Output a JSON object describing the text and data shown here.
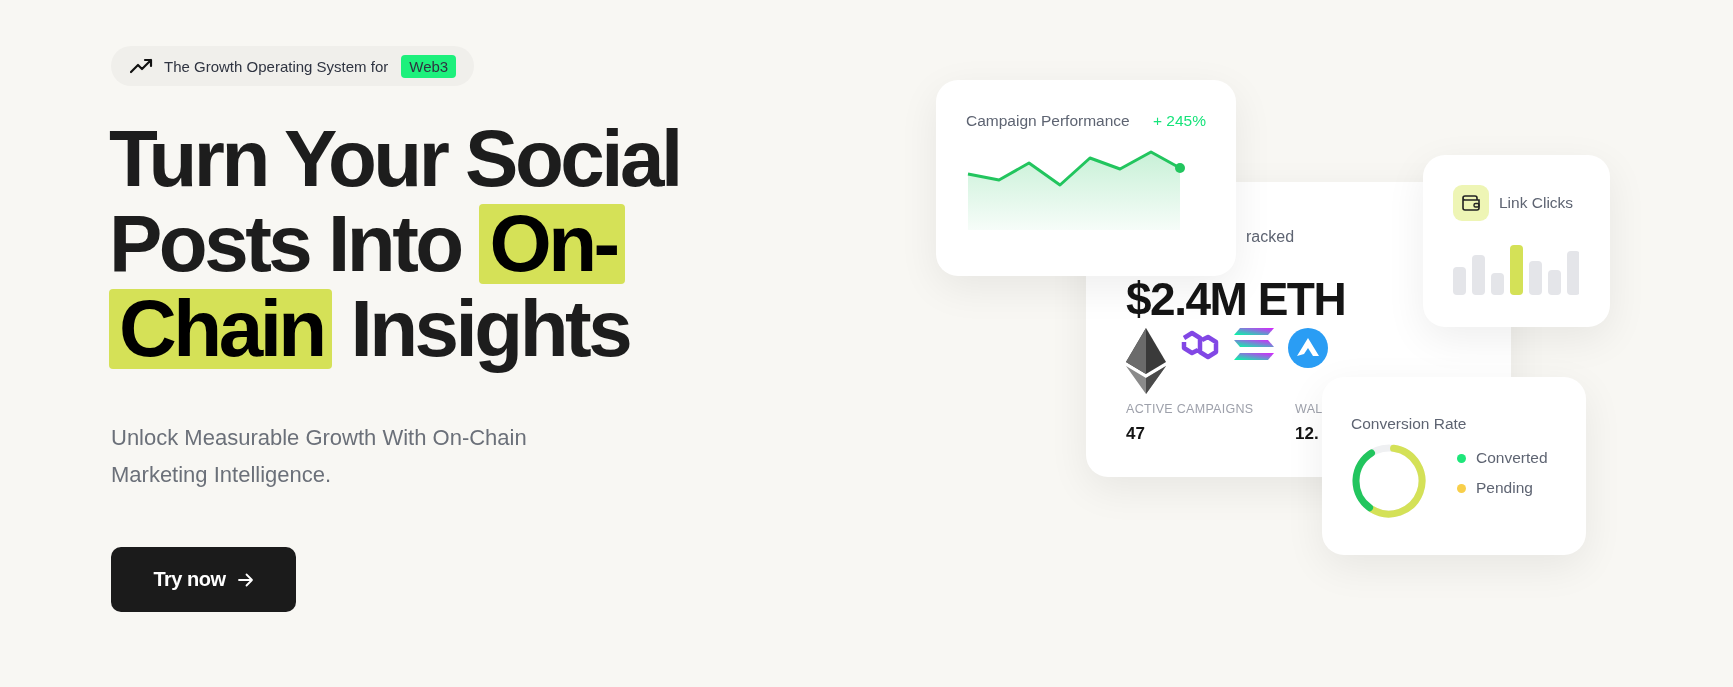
{
  "badge": {
    "text": "The Growth Operating System for",
    "tag": "Web3"
  },
  "headline": [
    [
      {
        "text": "Turn Your Social",
        "highlighted": false
      }
    ],
    [
      {
        "text": "Posts Into ",
        "highlighted": false
      },
      {
        "text": "On-",
        "highlighted": true
      }
    ],
    [
      {
        "text": "Chain",
        "highlighted": true
      },
      {
        "text": " Insights",
        "highlighted": false
      }
    ]
  ],
  "subtitle": "Unlock Measurable Growth With On-Chain Marketing Intelligence.",
  "cta": {
    "label": "Try now"
  },
  "campaign_card": {
    "title": "Campaign Performance",
    "change": "+ 245%"
  },
  "value_card": {
    "label": "racked",
    "value": "$2.4M ETH",
    "stats": [
      {
        "label": "ACTIVE CAMPAIGNS",
        "value": "47"
      },
      {
        "label": "WAL",
        "value": "12."
      }
    ]
  },
  "link_card": {
    "title": "Link Clicks"
  },
  "conversion_card": {
    "title": "Conversion Rate",
    "legend": [
      {
        "label": "Converted",
        "color": "#1ee67a"
      },
      {
        "label": "Pending",
        "color": "#f8cf4a"
      }
    ]
  }
}
